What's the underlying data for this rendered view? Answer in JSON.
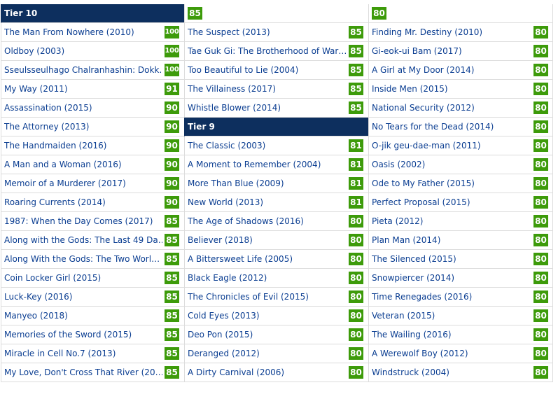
{
  "colors": {
    "header_bg": "#0d2f5e",
    "score_bg": "#3d9b0a",
    "title_text": "#0a3d91",
    "grid": "#dcdcdc"
  },
  "columns": [
    {
      "rows": [
        {
          "kind": "header",
          "label": "Tier 10"
        },
        {
          "kind": "movie",
          "title": "The Man From Nowhere (2010)",
          "score": "100"
        },
        {
          "kind": "movie",
          "title": "Oldboy (2003)",
          "score": "100"
        },
        {
          "kind": "movie",
          "title": "Sseulsseulhago Chalranhashin: Dokk…",
          "score": "100"
        },
        {
          "kind": "movie",
          "title": "My Way (2011)",
          "score": "91"
        },
        {
          "kind": "movie",
          "title": "Assassination (2015)",
          "score": "90"
        },
        {
          "kind": "movie",
          "title": "The Attorney (2013)",
          "score": "90"
        },
        {
          "kind": "movie",
          "title": "The Handmaiden (2016)",
          "score": "90"
        },
        {
          "kind": "movie",
          "title": "A Man and a Woman (2016)",
          "score": "90"
        },
        {
          "kind": "movie",
          "title": "Memoir of a Murderer (2017)",
          "score": "90"
        },
        {
          "kind": "movie",
          "title": "Roaring Currents (2014)",
          "score": "90"
        },
        {
          "kind": "movie",
          "title": "1987: When the Day Comes (2017)",
          "score": "85"
        },
        {
          "kind": "movie",
          "title": "Along with the Gods: The Last 49 Da…",
          "score": "85"
        },
        {
          "kind": "movie",
          "title": "Along With the Gods: The Two Worl…",
          "score": "85"
        },
        {
          "kind": "movie",
          "title": "Coin Locker Girl (2015)",
          "score": "85"
        },
        {
          "kind": "movie",
          "title": "Luck-Key (2016)",
          "score": "85"
        },
        {
          "kind": "movie",
          "title": "Manyeo (2018)",
          "score": "85"
        },
        {
          "kind": "movie",
          "title": "Memories of the Sword (2015)",
          "score": "85"
        },
        {
          "kind": "movie",
          "title": "Miracle in Cell No.7 (2013)",
          "score": "85"
        },
        {
          "kind": "movie",
          "title": "My Love, Don't Cross That River (20…",
          "score": "85"
        }
      ]
    },
    {
      "rows": [
        {
          "kind": "scoreonly",
          "score": "85"
        },
        {
          "kind": "movie",
          "title": "The Suspect (2013)",
          "score": "85"
        },
        {
          "kind": "movie",
          "title": "Tae Guk Gi: The Brotherhood of War…",
          "score": "85"
        },
        {
          "kind": "movie",
          "title": "Too Beautiful to Lie (2004)",
          "score": "85"
        },
        {
          "kind": "movie",
          "title": "The Villainess (2017)",
          "score": "85"
        },
        {
          "kind": "movie",
          "title": "Whistle Blower (2014)",
          "score": "85"
        },
        {
          "kind": "header",
          "label": "Tier 9"
        },
        {
          "kind": "movie",
          "title": "The Classic (2003)",
          "score": "81"
        },
        {
          "kind": "movie",
          "title": "A Moment to Remember (2004)",
          "score": "81"
        },
        {
          "kind": "movie",
          "title": "More Than Blue (2009)",
          "score": "81"
        },
        {
          "kind": "movie",
          "title": "New World (2013)",
          "score": "81"
        },
        {
          "kind": "movie",
          "title": "The Age of Shadows (2016)",
          "score": "80"
        },
        {
          "kind": "movie",
          "title": "Believer (2018)",
          "score": "80"
        },
        {
          "kind": "movie",
          "title": "A Bittersweet Life (2005)",
          "score": "80"
        },
        {
          "kind": "movie",
          "title": "Black Eagle (2012)",
          "score": "80"
        },
        {
          "kind": "movie",
          "title": "The Chronicles of Evil (2015)",
          "score": "80"
        },
        {
          "kind": "movie",
          "title": "Cold Eyes (2013)",
          "score": "80"
        },
        {
          "kind": "movie",
          "title": "Deo Pon (2015)",
          "score": "80"
        },
        {
          "kind": "movie",
          "title": "Deranged (2012)",
          "score": "80"
        },
        {
          "kind": "movie",
          "title": "A Dirty Carnival (2006)",
          "score": "80"
        }
      ]
    },
    {
      "rows": [
        {
          "kind": "scoreonly",
          "score": "80"
        },
        {
          "kind": "movie",
          "title": "Finding Mr. Destiny (2010)",
          "score": "80"
        },
        {
          "kind": "movie",
          "title": "Gi-eok-ui Bam (2017)",
          "score": "80"
        },
        {
          "kind": "movie",
          "title": "A Girl at My Door (2014)",
          "score": "80"
        },
        {
          "kind": "movie",
          "title": "Inside Men (2015)",
          "score": "80"
        },
        {
          "kind": "movie",
          "title": "National Security (2012)",
          "score": "80"
        },
        {
          "kind": "movie",
          "title": "No Tears for the Dead (2014)",
          "score": "80"
        },
        {
          "kind": "movie",
          "title": "O-jik geu-dae-man (2011)",
          "score": "80"
        },
        {
          "kind": "movie",
          "title": "Oasis (2002)",
          "score": "80"
        },
        {
          "kind": "movie",
          "title": "Ode to My Father (2015)",
          "score": "80"
        },
        {
          "kind": "movie",
          "title": "Perfect Proposal (2015)",
          "score": "80"
        },
        {
          "kind": "movie",
          "title": "Pieta (2012)",
          "score": "80"
        },
        {
          "kind": "movie",
          "title": "Plan Man (2014)",
          "score": "80"
        },
        {
          "kind": "movie",
          "title": "The Silenced (2015)",
          "score": "80"
        },
        {
          "kind": "movie",
          "title": "Snowpiercer (2014)",
          "score": "80"
        },
        {
          "kind": "movie",
          "title": "Time Renegades (2016)",
          "score": "80"
        },
        {
          "kind": "movie",
          "title": "Veteran (2015)",
          "score": "80"
        },
        {
          "kind": "movie",
          "title": "The Wailing (2016)",
          "score": "80"
        },
        {
          "kind": "movie",
          "title": "A Werewolf Boy (2012)",
          "score": "80"
        },
        {
          "kind": "movie",
          "title": "Windstruck (2004)",
          "score": "80"
        }
      ]
    }
  ]
}
